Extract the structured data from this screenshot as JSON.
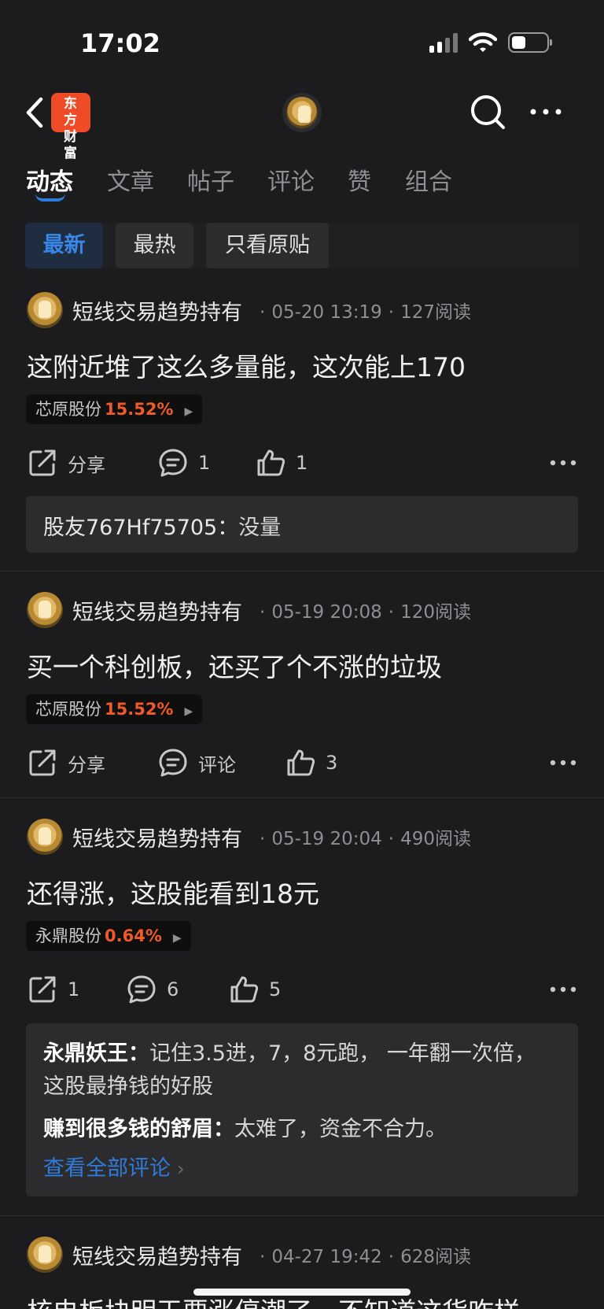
{
  "status_bar": {
    "time": "17:02"
  },
  "nav": {
    "logo_text": "东方财富"
  },
  "tabs": [
    {
      "label": "动态",
      "active": true
    },
    {
      "label": "文章"
    },
    {
      "label": "帖子"
    },
    {
      "label": "评论"
    },
    {
      "label": "赞"
    },
    {
      "label": "组合"
    }
  ],
  "filters": [
    {
      "label": "最新",
      "active": true
    },
    {
      "label": "最热"
    },
    {
      "label": "只看原贴"
    }
  ],
  "colors": {
    "accent": "#2f7bdc",
    "stock_up": "#f05a28",
    "brand": "#ef4b26"
  },
  "posts": [
    {
      "author": "短线交易趋势持有",
      "time": "05-20 13:19",
      "reads": "127阅读",
      "text": "这附近堆了这么多量能，这次能上170",
      "stock": {
        "name": "芯原股份",
        "change": "15.52%"
      },
      "share": "分享",
      "comments": "1",
      "likes": "1",
      "replies": [
        {
          "user": "股友767Hf75705：",
          "text": "没量"
        }
      ]
    },
    {
      "author": "短线交易趋势持有",
      "time": "05-19 20:08",
      "reads": "120阅读",
      "text": "买一个科创板，还买了个不涨的垃圾",
      "stock": {
        "name": "芯原股份",
        "change": "15.52%"
      },
      "share": "分享",
      "comments": "评论",
      "likes": "3"
    },
    {
      "author": "短线交易趋势持有",
      "time": "05-19 20:04",
      "reads": "490阅读",
      "text": "还得涨，这股能看到18元",
      "stock": {
        "name": "永鼎股份",
        "change": "0.64%"
      },
      "share": "1",
      "comments": "6",
      "likes": "5",
      "replies": [
        {
          "user": "永鼎妖王：",
          "text": "记住3.5进，7，8元跑，  一年翻一次倍，",
          "text_cont": "这股最挣钱的好股"
        },
        {
          "user": "赚到很多钱的舒眉：",
          "text": "太难了，资金不合力。"
        }
      ],
      "view_all": "查看全部评论"
    },
    {
      "author": "短线交易趋势持有",
      "time": "04-27 19:42",
      "reads": "628阅读",
      "text": "核电板块明天要涨停潮了，不知道这货咋样"
    }
  ]
}
